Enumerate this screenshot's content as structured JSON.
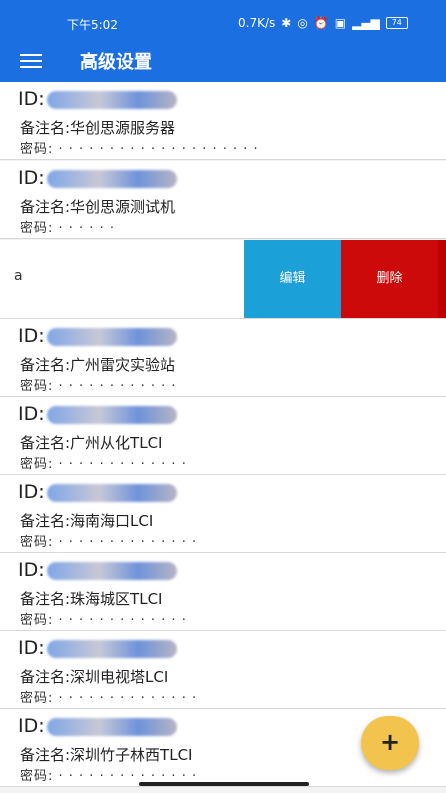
{
  "status_bar": {
    "time": "下午5:02",
    "speed": "0.7K/s",
    "battery": "74"
  },
  "toolbar": {
    "title": "高级设置"
  },
  "swipe_row": {
    "partial_text": "a",
    "edit_label": "编辑",
    "delete_label": "删除"
  },
  "devices": [
    {
      "id_label": "ID:",
      "remark": "备注名:华创思源服务器",
      "password": "密码: · · · · · · · · · · · · · · · · · · · ·"
    },
    {
      "id_label": "ID:",
      "remark": "备注名:华创思源测试机",
      "password": "密码: · · · · · ·"
    },
    {
      "id_label": "ID:",
      "remark": "备注名:广州雷灾实验站",
      "password": "密码: · · · · · · · · · · · ·"
    },
    {
      "id_label": "ID:",
      "remark": "备注名:广州从化TLCI",
      "password": "密码: · · · · · · · · · · · · ·"
    },
    {
      "id_label": "ID:",
      "remark": "备注名:海南海口LCI",
      "password": "密码: · · · · · · · · · · · · · ·"
    },
    {
      "id_label": "ID:",
      "remark": "备注名:珠海城区TLCI",
      "password": "密码: · · · · · · · · · · · · ·"
    },
    {
      "id_label": "ID:",
      "remark": "备注名:深圳电视塔LCI",
      "password": "密码: · · · · · · · · · · · · · ·"
    },
    {
      "id_label": "ID:",
      "remark": "备注名:深圳竹子林西TLCI",
      "password": "密码: · · · · · · · · · · · · · ·"
    }
  ],
  "fab": {
    "label": "+"
  },
  "colors": {
    "appbar": "#1c6fe0",
    "edit": "#1ca0d8",
    "delete": "#cc0a0a",
    "fab": "#f2c44e"
  }
}
